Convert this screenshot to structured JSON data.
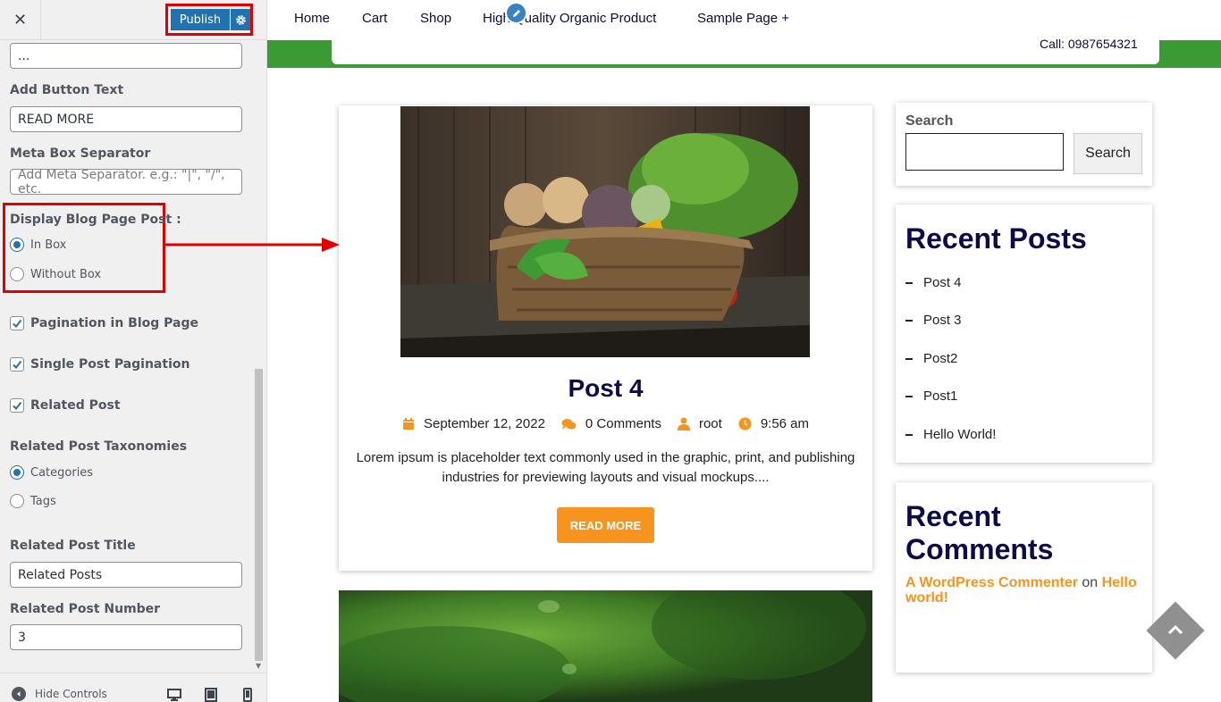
{
  "customizer": {
    "close_label": "✕",
    "publish_label": "Publish",
    "fields": {
      "top_input_value": "...",
      "add_button_text_label": "Add Button Text",
      "add_button_text_value": "READ MORE",
      "meta_separator_label": "Meta Box Separator",
      "meta_separator_placeholder": "Add Meta Separator. e.g.: \"|\", \"/\", etc.",
      "display_blog_label": "Display Blog Page Post :",
      "display_options": [
        {
          "label": "In Box",
          "selected": true
        },
        {
          "label": "Without Box",
          "selected": false
        }
      ],
      "checkboxes": [
        {
          "label": "Pagination in Blog Page",
          "checked": true
        },
        {
          "label": "Single Post Pagination",
          "checked": true
        },
        {
          "label": "Related Post",
          "checked": true
        }
      ],
      "taxonomies_label": "Related Post Taxonomies",
      "taxonomy_options": [
        {
          "label": "Categories",
          "selected": true
        },
        {
          "label": "Tags",
          "selected": false
        }
      ],
      "related_title_label": "Related Post Title",
      "related_title_value": "Related Posts",
      "related_number_label": "Related Post Number",
      "related_number_value": "3"
    },
    "footer": {
      "hide_controls_label": "Hide Controls",
      "devices": [
        "desktop-icon",
        "tablet-icon",
        "mobile-icon"
      ]
    }
  },
  "preview": {
    "nav": [
      "Home",
      "Cart",
      "Shop",
      "High Quality Organic Product",
      "Sample Page +"
    ],
    "call_text": "Call: 0987654321",
    "post": {
      "title": "Post 4",
      "date": "September 12, 2022",
      "comments": "0 Comments",
      "author": "root",
      "time": "9:56 am",
      "excerpt": "Lorem ipsum is placeholder text commonly used in the graphic, print, and publishing industries for previewing layouts and visual mockups....",
      "read_more": "READ MORE"
    },
    "sidebar": {
      "search_label": "Search",
      "search_button": "Search",
      "recent_posts_title": "Recent Posts",
      "recent_posts": [
        "Post 4",
        "Post 3",
        "Post2",
        "Post1",
        "Hello World!"
      ],
      "recent_comments_title": "Recent Comments",
      "comment_author": "A WordPress Commenter",
      "comment_on": "on",
      "comment_post": "Hello world!"
    }
  },
  "colors": {
    "accent_orange": "#f7941d",
    "publish_blue": "#2271b1",
    "highlight_red": "#e00000",
    "header_green": "#3a9b35",
    "title_navy": "#0b0b4b"
  }
}
